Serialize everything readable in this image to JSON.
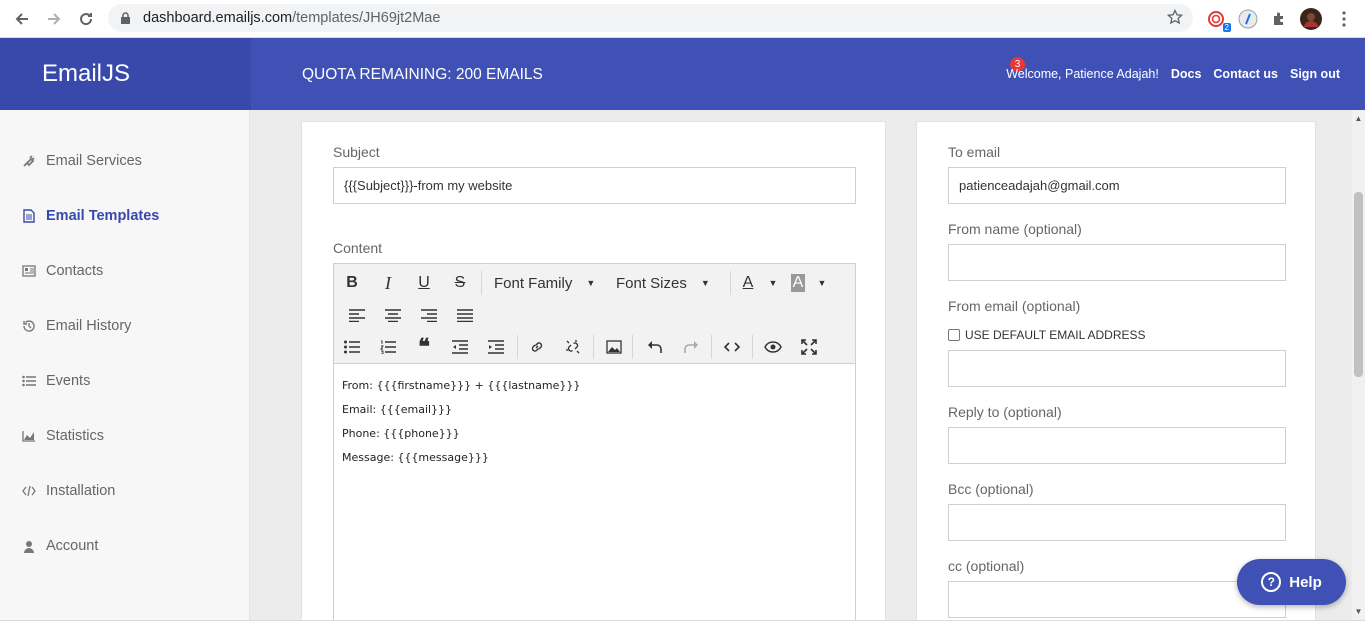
{
  "browser": {
    "url_host": "dashboard.emailjs.com",
    "url_path": "/templates/JH69jt2Mae",
    "extension_badge": "2"
  },
  "header": {
    "brand": "EmailJS",
    "quota": "QUOTA REMAINING: 200 EMAILS",
    "notification_count": "3",
    "welcome": "Welcome, Patience Adajah!",
    "docs": "Docs",
    "contact": "Contact us",
    "signout": "Sign out"
  },
  "sidebar": {
    "items": [
      {
        "label": "Email Services",
        "icon": "plug-icon"
      },
      {
        "label": "Email Templates",
        "icon": "document-icon",
        "active": true
      },
      {
        "label": "Contacts",
        "icon": "contact-card-icon"
      },
      {
        "label": "Email History",
        "icon": "history-icon"
      },
      {
        "label": "Events",
        "icon": "list-icon"
      },
      {
        "label": "Statistics",
        "icon": "area-chart-icon"
      },
      {
        "label": "Installation",
        "icon": "code-icon"
      },
      {
        "label": "Account",
        "icon": "user-icon"
      }
    ]
  },
  "template": {
    "subject_label": "Subject",
    "subject_value": "{{{Subject}}}-from my website",
    "content_label": "Content",
    "toolbar": {
      "font_family": "Font Family",
      "font_sizes": "Font Sizes"
    },
    "content_lines": [
      "From: {{{firstname}}} + {{{lastname}}}",
      "Email: {{{email}}}",
      "Phone: {{{phone}}}",
      "Message: {{{message}}}"
    ]
  },
  "settings": {
    "to_email_label": "To email",
    "to_email_value": "patienceadajah@gmail.com",
    "from_name_label": "From name (optional)",
    "from_name_value": "",
    "from_email_label": "From email (optional)",
    "default_email_checkbox": "USE DEFAULT EMAIL ADDRESS",
    "from_email_value": "",
    "reply_to_label": "Reply to (optional)",
    "reply_to_value": "",
    "bcc_label": "Bcc (optional)",
    "bcc_value": "",
    "cc_label": "cc (optional)",
    "cc_value": ""
  },
  "help_button": "Help",
  "colors": {
    "header": "#3f51b5",
    "brand_bg": "#3949ab",
    "active_nav": "#3949ab",
    "badge": "#e53935"
  }
}
